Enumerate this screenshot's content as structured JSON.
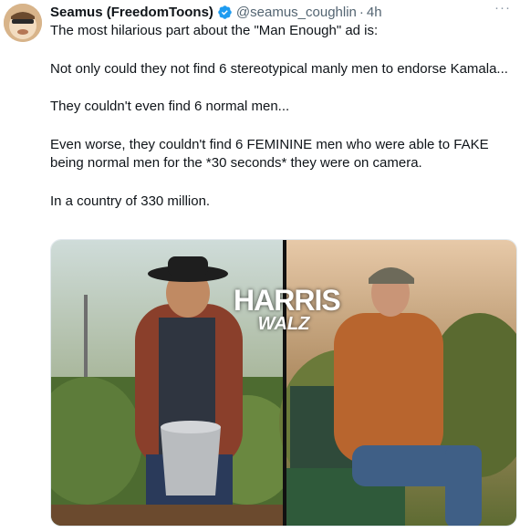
{
  "post": {
    "author_name": "Seamus (FreedomToons)",
    "handle": "@seamus_coughlin",
    "separator": "·",
    "time": "4h",
    "more_label": "···",
    "paragraphs": [
      "The most hilarious part about the \"Man Enough\" ad is:",
      "Not only could they not find 6 stereotypical manly men to endorse Kamala...",
      "They couldn't even find 6 normal men...",
      "Even worse, they couldn't find 6 FEMININE men who were able to FAKE being normal men for the *30 seconds* they were on camera.",
      "In a country of 330 million."
    ]
  },
  "media": {
    "logo_line1": "HARRIS",
    "logo_line2": "WALZ"
  },
  "colors": {
    "verified": "#1d9bf0",
    "text": "#0f1419",
    "secondary": "#536471"
  },
  "icons": {
    "verified": "verified-badge-icon",
    "more": "more-icon"
  }
}
